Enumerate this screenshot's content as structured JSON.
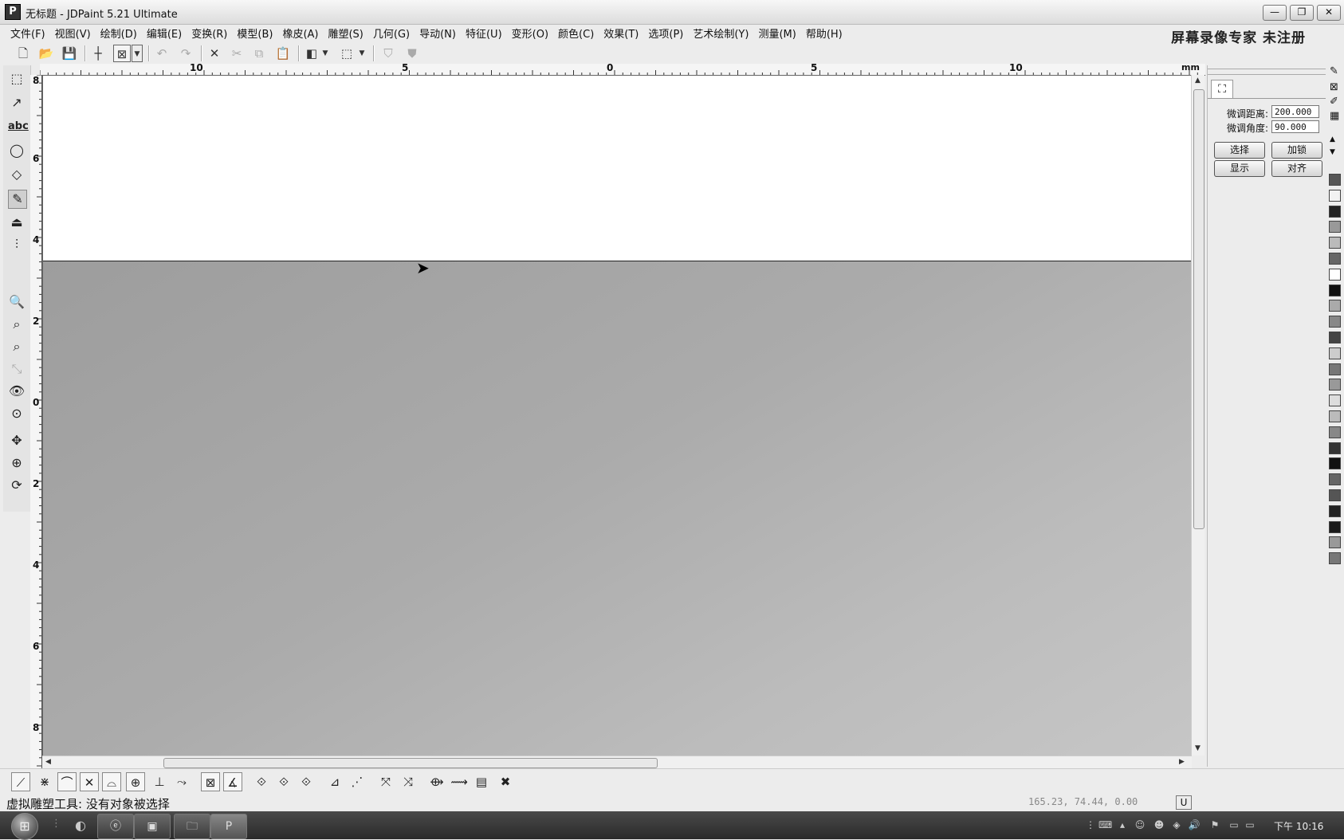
{
  "window": {
    "title": "无标题 - JDPaint 5.21 Ultimate",
    "app_icon_glyph": "P",
    "minimize": "—",
    "restore": "❐",
    "close": "✕"
  },
  "menu": [
    "文件(F)",
    "视图(V)",
    "绘制(D)",
    "编辑(E)",
    "变换(R)",
    "模型(B)",
    "橡皮(A)",
    "雕塑(S)",
    "几何(G)",
    "导动(N)",
    "特征(U)",
    "变形(O)",
    "颜色(C)",
    "效果(T)",
    "选项(P)",
    "艺术绘制(Y)",
    "测量(M)",
    "帮助(H)"
  ],
  "watermark": "屏幕录像专家  未注册",
  "ruler": {
    "unit": "mm",
    "h_labels": [
      "10",
      "5",
      "0",
      "5",
      "10"
    ],
    "v_labels": [
      "8",
      "6",
      "4",
      "2",
      "0",
      "2",
      "4",
      "6",
      "8"
    ]
  },
  "panel": {
    "tab_icon": "node-select-icon",
    "fine_distance_label": "微调距离:",
    "fine_distance_value": "200.000",
    "fine_angle_label": "微调角度:",
    "fine_angle_value": "90.000",
    "buttons": {
      "select": "选择",
      "lock": "加锁",
      "display": "显示",
      "align": "对齐"
    }
  },
  "palette_colors": [
    "#555555",
    "#f2f2f2",
    "#222222",
    "#999999",
    "#bbbbbb",
    "#666666",
    "#ffffff",
    "#111111",
    "#aaaaaa",
    "#888888",
    "#444444",
    "#cccccc",
    "#777777",
    "#999999",
    "#dddddd",
    "#bbbbbb",
    "#888888",
    "#333333",
    "#111111",
    "#666666",
    "#555555",
    "#222222",
    "#1a1a1a",
    "#999999",
    "#777777"
  ],
  "status": {
    "message": "虚拟雕塑工具: 没有对象被选择",
    "coords": "165.23, 74.44, 0.00",
    "mode_indicator": "U"
  },
  "taskbar": {
    "clock": "下午 10:16"
  }
}
